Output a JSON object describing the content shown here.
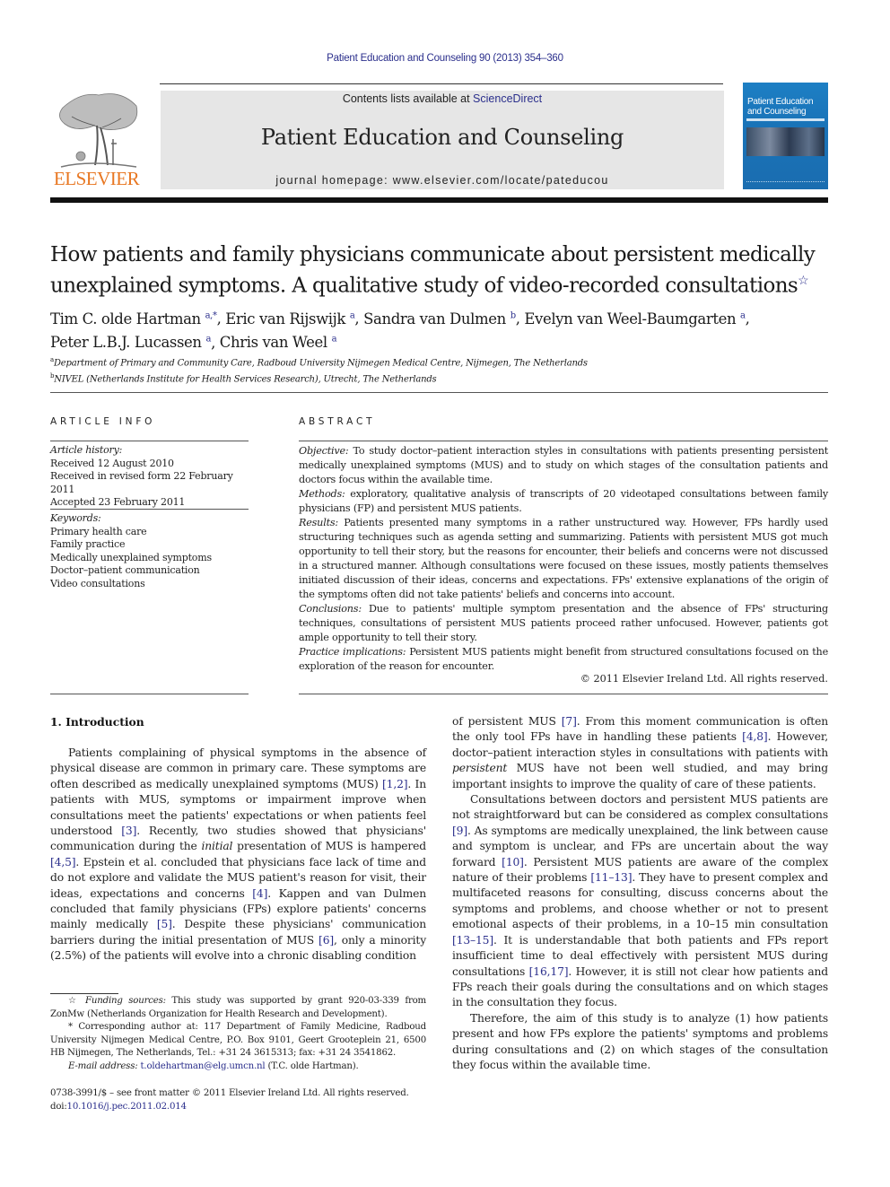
{
  "running_head": "Patient Education and Counseling 90 (2013) 354–360",
  "masthead": {
    "publisher_logo_text": "ELSEVIER",
    "contents_prefix": "Contents lists available at ",
    "contents_link": "ScienceDirect",
    "journal_title": "Patient Education and Counseling",
    "homepage_label": "journal homepage: ",
    "homepage_url": "www.elsevier.com/locate/pateducou",
    "cover_title_line1": "Patient Education",
    "cover_title_line2": "and Counseling"
  },
  "colors": {
    "link": "#2b2f8c",
    "elsevier_orange": "#e87722",
    "masthead_bg": "#e6e6e6",
    "cover_blue": "#1a6db0"
  },
  "article": {
    "title_line1": "How patients and family physicians communicate about persistent medically",
    "title_line2": "unexplained symptoms. A qualitative study of video-recorded consultations",
    "title_note_mark": "☆",
    "authors": [
      {
        "name": "Tim C. olde Hartman",
        "sup": "a,*",
        "sep": ", "
      },
      {
        "name": "Eric van Rijswijk",
        "sup": "a",
        "sep": ", "
      },
      {
        "name": "Sandra van Dulmen",
        "sup": "b",
        "sep": ", "
      },
      {
        "name": "Evelyn van Weel-Baumgarten",
        "sup": "a",
        "sep": ","
      },
      {
        "name": "Peter L.B.J. Lucassen",
        "sup": "a",
        "sep": ", "
      },
      {
        "name": "Chris van Weel",
        "sup": "a",
        "sep": ""
      }
    ],
    "affiliations": [
      {
        "mark": "a",
        "text": "Department of Primary and Community Care, Radboud University Nijmegen Medical Centre, Nijmegen, The Netherlands"
      },
      {
        "mark": "b",
        "text": "NIVEL (Netherlands Institute for Health Services Research), Utrecht, The Netherlands"
      }
    ]
  },
  "article_info": {
    "label": "ARTICLE INFO",
    "history_heading": "Article history:",
    "history": [
      "Received 12 August 2010",
      "Received in revised form 22 February 2011",
      "Accepted 23 February 2011"
    ],
    "keywords_heading": "Keywords:",
    "keywords": [
      "Primary health care",
      "Family practice",
      "Medically unexplained symptoms",
      "Doctor–patient communication",
      "Video consultations"
    ]
  },
  "abstract": {
    "label": "ABSTRACT",
    "sections": [
      {
        "heading": "Objective:",
        "text": " To study doctor–patient interaction styles in consultations with patients presenting persistent medically unexplained symptoms (MUS) and to study on which stages of the consultation patients and doctors focus within the available time."
      },
      {
        "heading": "Methods:",
        "text": " exploratory, qualitative analysis of transcripts of 20 videotaped consultations between family physicians (FP) and persistent MUS patients."
      },
      {
        "heading": "Results:",
        "text": " Patients presented many symptoms in a rather unstructured way. However, FPs hardly used structuring techniques such as agenda setting and summarizing. Patients with persistent MUS got much opportunity to tell their story, but the reasons for encounter, their beliefs and concerns were not discussed in a structured manner. Although consultations were focused on these issues, mostly patients themselves initiated discussion of their ideas, concerns and expectations. FPs' extensive explanations of the origin of the symptoms often did not take patients' beliefs and concerns into account."
      },
      {
        "heading": "Conclusions:",
        "text": " Due to patients' multiple symptom presentation and the absence of FPs' structuring techniques, consultations of persistent MUS patients proceed rather unfocused. However, patients got ample opportunity to tell their story."
      },
      {
        "heading": "Practice implications:",
        "text": " Persistent MUS patients might benefit from structured consultations focused on the exploration of the reason for encounter."
      }
    ],
    "copyright": "© 2011 Elsevier Ireland Ltd. All rights reserved."
  },
  "introduction": {
    "heading": "1.  Introduction",
    "left_paragraph": [
      {
        "t": "Patients complaining of physical symptoms in the absence of physical disease are common in primary care. These symptoms are often described as medically unexplained symptoms (MUS) "
      },
      {
        "c": "[1,2]"
      },
      {
        "t": ". In patients with MUS, symptoms or impairment improve when consultations meet the patients' expectations or when patients feel understood "
      },
      {
        "c": "[3]"
      },
      {
        "t": ". Recently, two studies showed that physicians' communication during the "
      },
      {
        "i": "initial"
      },
      {
        "t": " presentation of MUS is hampered "
      },
      {
        "c": "[4,5]"
      },
      {
        "t": ". Epstein et al. concluded that physicians face lack of time and do not explore and validate the MUS patient's reason for visit, their ideas, expectations and concerns "
      },
      {
        "c": "[4]"
      },
      {
        "t": ". Kappen and van Dulmen concluded that family physicians (FPs) explore patients' concerns mainly medically "
      },
      {
        "c": "[5]"
      },
      {
        "t": ". Despite these physicians' communication barriers during the initial presentation of MUS "
      },
      {
        "c": "[6]"
      },
      {
        "t": ", only a minority (2.5%) of the patients will evolve into a chronic disabling condition"
      }
    ],
    "right_paragraphs": [
      {
        "indent": false,
        "runs": [
          {
            "t": "of persistent MUS "
          },
          {
            "c": "[7]"
          },
          {
            "t": ". From this moment communication is often the only tool FPs have in handling these patients "
          },
          {
            "c": "[4,8]"
          },
          {
            "t": ". However, doctor–patient interaction styles in consultations with patients with "
          },
          {
            "i": "persistent"
          },
          {
            "t": " MUS have not been well studied, and may bring important insights to improve the quality of care of these patients."
          }
        ]
      },
      {
        "indent": true,
        "runs": [
          {
            "t": "Consultations between doctors and persistent MUS patients are not straightforward but can be considered as complex consultations "
          },
          {
            "c": "[9]"
          },
          {
            "t": ". As symptoms are medically unexplained, the link between cause and symptom is unclear, and FPs are uncertain about the way forward "
          },
          {
            "c": "[10]"
          },
          {
            "t": ". Persistent MUS patients are aware of the complex nature of their problems "
          },
          {
            "c": "[11–13]"
          },
          {
            "t": ". They have to present complex and multifaceted reasons for consulting, discuss concerns about the symptoms and problems, and choose whether or not to present emotional aspects of their problems, in a 10–15 min consultation "
          },
          {
            "c": "[13–15]"
          },
          {
            "t": ". It is understandable that both patients and FPs report insufficient time to deal effectively with persistent MUS during consultations "
          },
          {
            "c": "[16,17]"
          },
          {
            "t": ". However, it is still not clear how patients and FPs reach their goals during the consultations and on which stages in the consultation they focus."
          }
        ]
      },
      {
        "indent": true,
        "runs": [
          {
            "t": "Therefore, the aim of this study is to analyze (1) how patients present and how FPs explore the patients' symptoms and problems during consultations and (2) on which stages of the consultation they focus within the available time."
          }
        ]
      }
    ]
  },
  "footnotes": {
    "funding_mark": "☆",
    "funding_heading": "Funding sources:",
    "funding_text": " This study was supported by grant 920-03-339 from ZonMw (Netherlands Organization for Health Research and Development).",
    "corresponding_mark": "*",
    "corresponding_text": " Corresponding author at: 117 Department of Family Medicine, Radboud University Nijmegen Medical Centre, P.O. Box 9101, Geert Grooteplein 21, 6500 HB Nijmegen, The Netherlands, Tel.: +31 24 3615313; fax: +31 24 3541862.",
    "email_label": "E-mail address:",
    "email": "t.oldehartman@elg.umcn.nl",
    "email_suffix": " (T.C. olde Hartman).",
    "issn_line": "0738-3991/$ – see front matter © 2011 Elsevier Ireland Ltd. All rights reserved.",
    "doi_label": "doi:",
    "doi": "10.1016/j.pec.2011.02.014"
  }
}
